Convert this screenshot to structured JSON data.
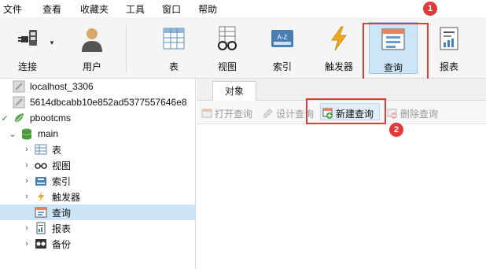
{
  "menu": [
    "文件",
    "查看",
    "收藏夹",
    "工具",
    "窗口",
    "帮助"
  ],
  "toolbar": {
    "connect": "连接",
    "user": "用户",
    "table": "表",
    "view": "视图",
    "index": "索引",
    "trigger": "触发器",
    "query": "查询",
    "report": "报表"
  },
  "annotations": {
    "badge1": "1",
    "badge2": "2"
  },
  "sidebar": {
    "items": [
      {
        "label": "localhost_3306"
      },
      {
        "label": "5614dbcabb10e852ad5377557646e8"
      },
      {
        "label": "pbootcms"
      },
      {
        "label": "main"
      },
      {
        "label": "表"
      },
      {
        "label": "视图"
      },
      {
        "label": "索引"
      },
      {
        "label": "触发器"
      },
      {
        "label": "查询"
      },
      {
        "label": "报表"
      },
      {
        "label": "备份"
      }
    ]
  },
  "main": {
    "tab": "对象",
    "actions": {
      "open": "打开查询",
      "design": "设计查询",
      "new": "新建查询",
      "delete": "删除查询"
    }
  },
  "colors": {
    "highlight": "#e03a3a",
    "selection": "#cce4f7",
    "active_tool": "#cde6f7"
  }
}
